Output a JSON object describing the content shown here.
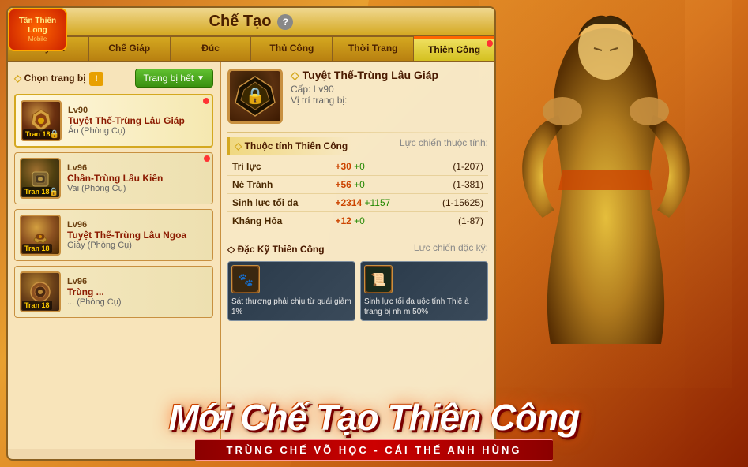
{
  "header": {
    "title": "Chế Tạo",
    "help_label": "?"
  },
  "tabs": [
    {
      "id": "may-va",
      "label": "May Vá",
      "active": false,
      "dot": false
    },
    {
      "id": "che-giap",
      "label": "Chế Giáp",
      "active": false,
      "dot": false
    },
    {
      "id": "duc",
      "label": "Đúc",
      "active": false,
      "dot": false
    },
    {
      "id": "thu-cong",
      "label": "Thủ Công",
      "active": false,
      "dot": false
    },
    {
      "id": "thoi-trang",
      "label": "Thời Trang",
      "active": false,
      "dot": false
    },
    {
      "id": "thien-cong",
      "label": "Thiên Công",
      "active": true,
      "dot": true
    }
  ],
  "left_panel": {
    "choose_label": "Chọn trang bị",
    "filter_btn": "Trang bị hết",
    "items": [
      {
        "id": 1,
        "level": "Lv90",
        "name": "Tuyệt Thế-Trùng Lâu Giáp",
        "type": "Áo (Phòng Cụ)",
        "selected": true,
        "dot": true,
        "tier": "Tran 18"
      },
      {
        "id": 2,
        "level": "Lv96",
        "name": "Chân-Trùng Lâu Kiên",
        "type": "Vai (Phòng Cụ)",
        "selected": false,
        "dot": true,
        "tier": "Tran 18"
      },
      {
        "id": 3,
        "level": "Lv96",
        "name": "Tuyệt Thế-Trùng Lâu Ngoa",
        "type": "Giày (Phòng Cụ)",
        "selected": false,
        "dot": false,
        "tier": "Tran 18"
      },
      {
        "id": 4,
        "level": "Lv96",
        "name": "Trùng ...",
        "type": "... (Phòng Cụ)",
        "selected": false,
        "dot": false,
        "tier": "Tran 18"
      }
    ]
  },
  "right_panel": {
    "item_name": "Tuyệt Thế-Trùng Lâu Giáp",
    "item_level": "Cấp: Lv90",
    "item_position_label": "Vị trí trang bị:",
    "item_position": "",
    "attributes_label": "Thuộc tính Thiên Công",
    "luc_chien_label": "Lực chiến thuộc tính:",
    "attributes": [
      {
        "name": "Trí lực",
        "value": "+30",
        "bonus": "+0",
        "range": "(1-207)"
      },
      {
        "name": "Né Tránh",
        "value": "+56",
        "bonus": "+0",
        "range": "(1-381)"
      },
      {
        "name": "Sinh lực tối đa",
        "value": "+2314",
        "bonus": "+1157",
        "range": "(1-15625)"
      },
      {
        "name": "Kháng Hỏa",
        "value": "+12",
        "bonus": "+0",
        "range": "(1-87)"
      }
    ],
    "special_label": "Đặc Kỹ Thiên Công",
    "special_luc_chien": "Lực chiến đặc kỹ:",
    "skills": [
      {
        "id": 1,
        "icon": "🐾",
        "text": "Sát thương phải chịu từ quái giảm 1%"
      },
      {
        "id": 2,
        "icon": "📜",
        "text": "Sinh lực tối đa uộc tính Thiê à trang bị nh m 50%"
      }
    ]
  },
  "bottom_banner": {
    "big_text": "Mới Chế Tạo Thiên Công",
    "sub_text": "TRÙNG CHẾ VÕ HỌC - CÁI THẾ ANH HÙNG"
  },
  "logo": {
    "main": "Tân Thiên Long",
    "sub": "Mobile"
  }
}
